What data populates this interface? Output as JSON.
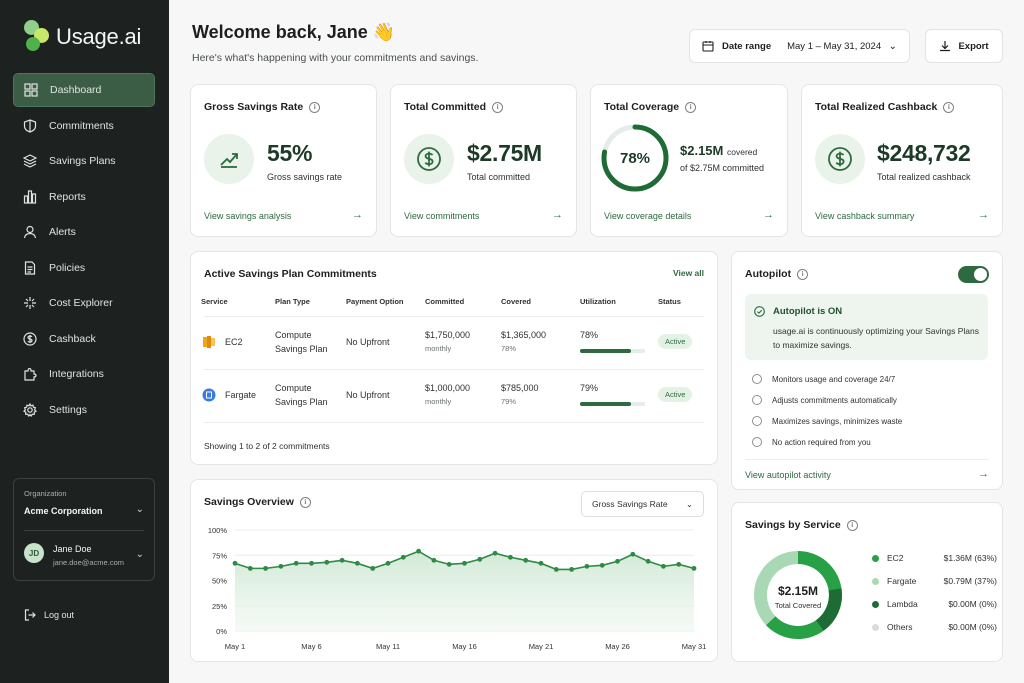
{
  "app": {
    "name": "Usage.ai"
  },
  "sidebar": {
    "items": [
      {
        "label": "Dashboard",
        "icon": "grid-icon",
        "active": true
      },
      {
        "label": "Commitments",
        "icon": "shield-icon"
      },
      {
        "label": "Savings Plans",
        "icon": "layers-icon"
      },
      {
        "label": "Reports",
        "icon": "bar-chart-icon"
      },
      {
        "label": "Alerts",
        "icon": "user-icon"
      },
      {
        "label": "Policies",
        "icon": "document-icon"
      },
      {
        "label": "Cost Explorer",
        "icon": "explorer-icon"
      },
      {
        "label": "Cashback",
        "icon": "dollar-circle-icon"
      },
      {
        "label": "Integrations",
        "icon": "puzzle-icon"
      },
      {
        "label": "Settings",
        "icon": "gear-icon"
      }
    ],
    "org_label": "Organization",
    "org_name": "Acme Corporation",
    "user_initials": "JD",
    "user_name": "Jane Doe",
    "user_email": "jane.doe@acme.com",
    "logout": "Log out"
  },
  "header": {
    "welcome": "Welcome back, Jane 👋",
    "subtitle": "Here's what's happening with your commitments and savings.",
    "date_label": "Date range",
    "date_value": "May 1 – May 31, 2024",
    "export": "Export"
  },
  "kpis": {
    "savings_rate": {
      "title": "Gross Savings Rate",
      "value": "55%",
      "sub": "Gross savings rate",
      "link": "View savings analysis"
    },
    "committed": {
      "title": "Total Committed",
      "value": "$2.75M",
      "sub": "Total committed",
      "link": "View commitments"
    },
    "coverage": {
      "title": "Total Coverage",
      "percent": "78%",
      "percent_value": 0.78,
      "covered": "$2.15M",
      "covered_suffix": "covered",
      "of": "of $2.75M committed",
      "link": "View coverage details"
    },
    "cashback": {
      "title": "Total Realized Cashback",
      "value": "$248,732",
      "sub": "Total realized cashback",
      "link": "View cashback summary"
    }
  },
  "commitments": {
    "title": "Active Savings Plan Commitments",
    "view_all": "View all",
    "columns": [
      "Service",
      "Plan Type",
      "Payment Option",
      "Committed",
      "Covered",
      "Utilization",
      "Status"
    ],
    "rows": [
      {
        "service": "EC2",
        "plan_line1": "Compute",
        "plan_line2": "Savings Plan",
        "payment": "No Upfront",
        "committed": "$1,750,000",
        "committed_sub": "monthly",
        "covered": "$1,365,000",
        "covered_sub": "78%",
        "utilization": "78%",
        "utilization_value": 0.78,
        "status": "Active",
        "icon_color": "#f2a516"
      },
      {
        "service": "Fargate",
        "plan_line1": "Compute",
        "plan_line2": "Savings Plan",
        "payment": "No Upfront",
        "committed": "$1,000,000",
        "committed_sub": "monthly",
        "covered": "$785,000",
        "covered_sub": "79%",
        "utilization": "79%",
        "utilization_value": 0.79,
        "status": "Active",
        "icon_color": "#3b7ae0"
      }
    ],
    "footer": "Showing 1 to 2 of 2 commitments"
  },
  "autopilot": {
    "title": "Autopilot",
    "on": "Autopilot is ON",
    "desc": "usage.ai is continuously optimizing your Savings Plans to maximize savings.",
    "features": [
      "Monitors usage and coverage 24/7",
      "Adjusts commitments automatically",
      "Maximizes savings, minimizes waste",
      "No action required from you"
    ],
    "link": "View autopilot activity"
  },
  "savings_overview": {
    "title": "Savings Overview",
    "select": "Gross Savings Rate"
  },
  "savings_by_service": {
    "title": "Savings by Service",
    "center_value": "$2.15M",
    "center_label": "Total Covered",
    "items": [
      {
        "name": "EC2",
        "value": "$1.36M (63%)",
        "color": "#27a046"
      },
      {
        "name": "Fargate",
        "value": "$0.79M (37%)",
        "color": "#a9d9b4"
      },
      {
        "name": "Lambda",
        "value": "$0.00M (0%)",
        "color": "#1f6b35"
      },
      {
        "name": "Others",
        "value": "$0.00M (0%)",
        "color": "#d8dcda"
      }
    ]
  },
  "colors": {
    "accent": "#2e6a3f",
    "sidebar": "#1d2220",
    "active_nav": "#3b5c45"
  },
  "chart_data": {
    "type": "area",
    "title": "Savings Overview",
    "xlabel": "",
    "ylabel": "",
    "ylim": [
      0,
      100
    ],
    "y_ticks": [
      "0%",
      "25%",
      "50%",
      "75%",
      "100%"
    ],
    "x_ticks": [
      "May 1",
      "May 6",
      "May 11",
      "May 16",
      "May 21",
      "May 26",
      "May 31"
    ],
    "x": [
      1,
      2,
      3,
      4,
      5,
      6,
      7,
      8,
      9,
      10,
      11,
      12,
      13,
      14,
      15,
      16,
      17,
      18,
      19,
      20,
      21,
      22,
      23,
      24,
      25,
      26,
      27,
      28,
      29,
      30,
      31
    ],
    "series": [
      {
        "values": [
          67,
          62,
          62,
          64,
          67,
          67,
          68,
          70,
          67,
          62,
          67,
          73,
          79,
          70,
          66,
          67,
          71,
          77,
          73,
          70,
          67,
          61,
          61,
          64,
          65,
          69,
          76,
          69,
          64,
          66,
          62
        ]
      }
    ],
    "grid": true
  }
}
